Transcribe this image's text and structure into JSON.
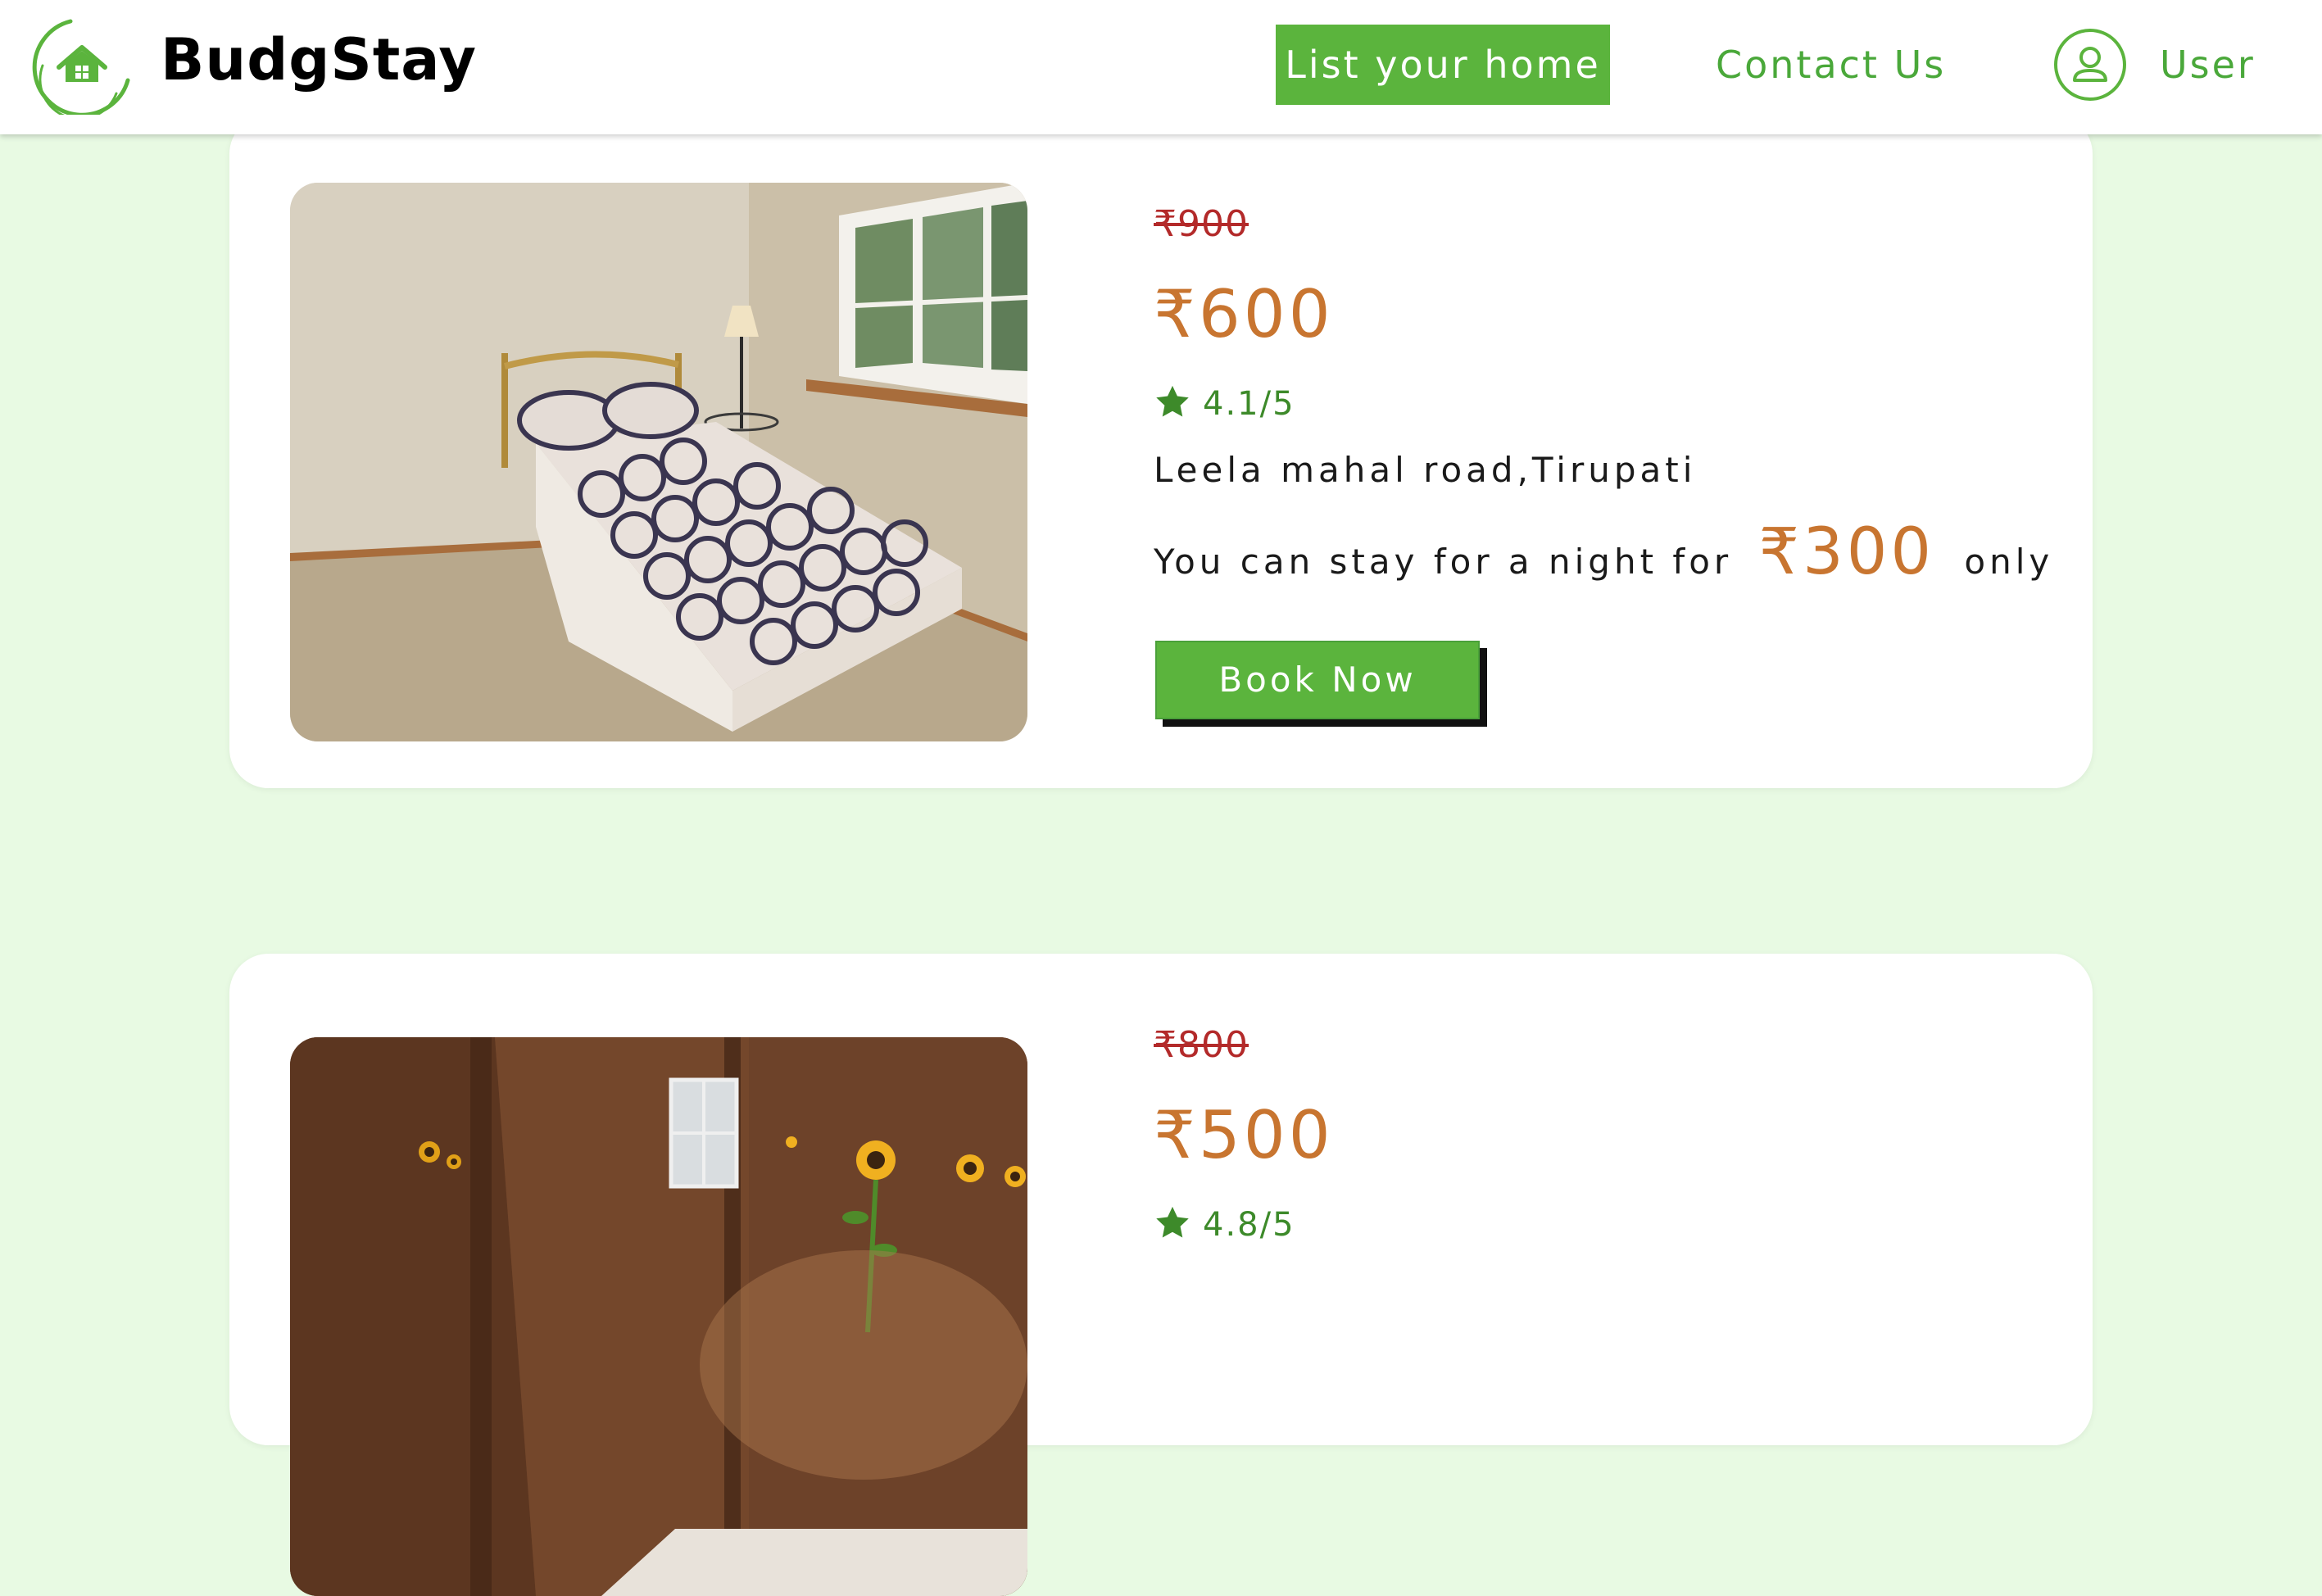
{
  "header": {
    "brand": "BudgStay",
    "list_home_label": "List your home",
    "contact_label": "Contact Us",
    "user_label": "User"
  },
  "colors": {
    "accent_green": "#5bb43d",
    "price_orange": "#c87530",
    "strike_red": "#b32a2a",
    "page_background": "#e8fae3"
  },
  "listings": [
    {
      "old_price": "₹900",
      "price": "₹600",
      "rating": "4.1/5",
      "address": "Leela mahal road,Tirupati",
      "offer_prefix": "You can stay for a night for",
      "offer_price": "₹300",
      "offer_suffix": "only",
      "book_label": "Book Now"
    },
    {
      "old_price": "₹800",
      "price": "₹500",
      "rating": "4.8/5"
    }
  ]
}
